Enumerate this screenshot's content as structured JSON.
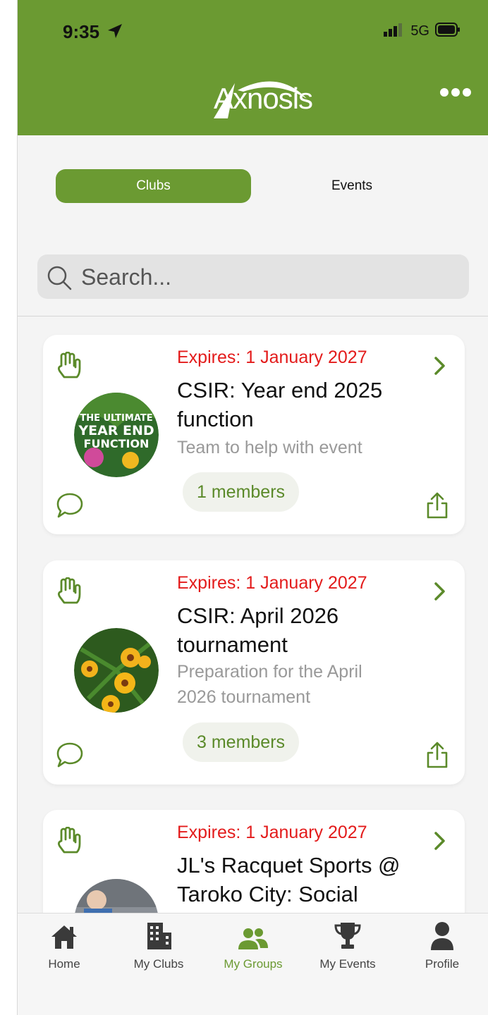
{
  "status": {
    "time": "9:35",
    "network": "5G"
  },
  "header": {
    "logo_text": "Axnosis"
  },
  "segments": {
    "clubs": "Clubs",
    "events": "Events"
  },
  "search": {
    "placeholder": "Search..."
  },
  "colors": {
    "brand": "#6b9a32",
    "expires": "#e31b1b",
    "members_text": "#5b8a2a"
  },
  "groups": [
    {
      "expires": "Expires: 1 January 2027",
      "title": "CSIR: Year end 2025 function",
      "description": "Team to help with event",
      "members": "1 members",
      "image": "year-end-function-poster"
    },
    {
      "expires": "Expires: 1 January 2027",
      "title": "CSIR: April 2026 tournament",
      "description": "Preparation for the April 2026 tournament",
      "members": "3 members",
      "image": "yellow-flowers-photo"
    },
    {
      "expires": "Expires: 1 January 2027",
      "title": "JL's Racquet Sports @ Taroko City: Social",
      "description": "",
      "members": "",
      "image": "person-photo"
    }
  ],
  "tabbar": {
    "items": [
      {
        "label": "Home",
        "icon": "home-icon"
      },
      {
        "label": "My Clubs",
        "icon": "building-icon"
      },
      {
        "label": "My Groups",
        "icon": "group-icon",
        "active": true
      },
      {
        "label": "My Events",
        "icon": "trophy-icon"
      },
      {
        "label": "Profile",
        "icon": "person-icon"
      }
    ]
  }
}
